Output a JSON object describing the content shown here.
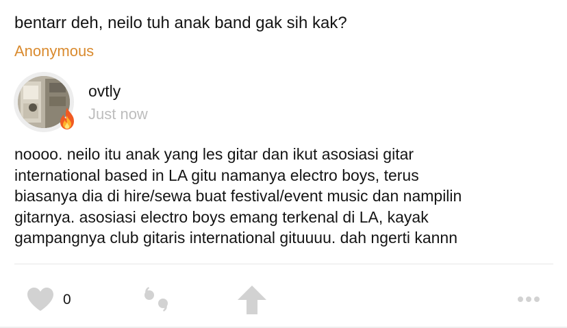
{
  "question": {
    "text": "bentarr deh, neilo tuh anak band gak sih kak?",
    "asker": "Anonymous"
  },
  "answer": {
    "author": {
      "username": "ovtly",
      "timestamp": "Just now",
      "avatar_badge": "fire-icon"
    },
    "lines": [
      "noooo. neilo itu anak yang les gitar dan ikut asosiasi gitar",
      "international based in LA gitu namanya electro boys, terus",
      "biasanya dia di hire/sewa buat festival/event music dan nampilin",
      "gitarnya. asosiasi electro boys emang terkenal di LA, kayak",
      "gampangnya club gitaris international gituuuu. dah ngerti kannn"
    ]
  },
  "actions": {
    "like_count": "0",
    "icons": [
      "heart-icon",
      "quote-icon",
      "repost-arrow-icon",
      "more-dots-icon"
    ]
  },
  "colors": {
    "asker": "#d98a2e",
    "timestamp": "#bdbdbd",
    "icon_gray": "#cfcfcf",
    "text": "#141414"
  }
}
